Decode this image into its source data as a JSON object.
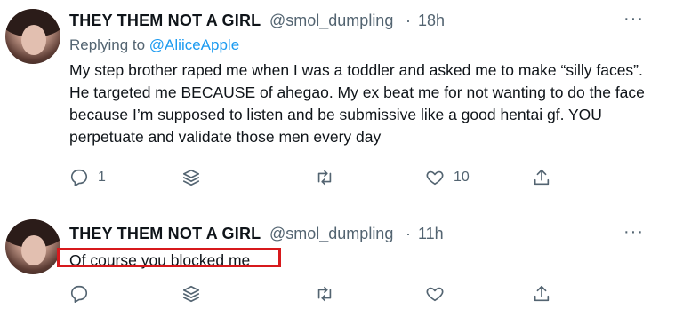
{
  "tweets": [
    {
      "display_name": "THEY THEM NOT A GIRL",
      "handle": "@smol_dumpling",
      "separator": "·",
      "time": "18h",
      "more": "···",
      "replying_prefix": "Replying to",
      "replying_to": "@AliiceApple",
      "text": "My step brother raped me when I was a toddler and asked me to make “silly faces”. He targeted me BECAUSE of ahegao. My ex beat me for not wanting to do the face because I’m supposed to listen and be submissive like a good hentai gf. YOU perpetuate and validate those men every day",
      "reply_count": "1",
      "like_count": "10"
    },
    {
      "display_name": "THEY THEM NOT A GIRL",
      "handle": "@smol_dumpling",
      "separator": "·",
      "time": "11h",
      "more": "···",
      "text": "Of course you blocked me",
      "reply_count": "",
      "like_count": ""
    }
  ],
  "icons": [
    "reply-icon",
    "stack-icon",
    "retweet-icon",
    "like-icon",
    "share-icon",
    "more-icon"
  ],
  "colors": {
    "link": "#1d9bf0",
    "muted": "#536471",
    "highlight": "#d7191c"
  }
}
